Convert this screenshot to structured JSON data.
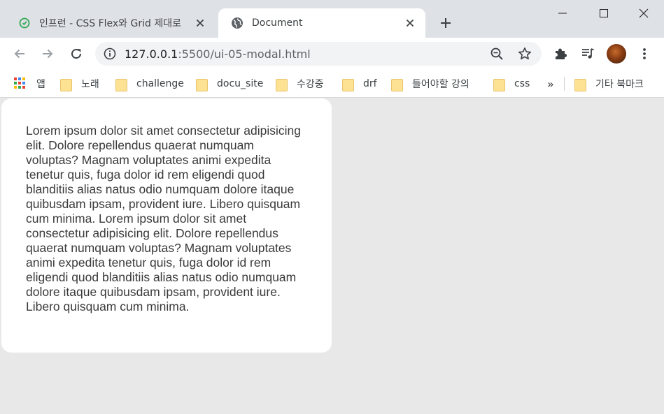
{
  "tabs": [
    {
      "title": "인프런 - CSS Flex와 Grid 제대로",
      "active": false
    },
    {
      "title": "Document",
      "active": true
    }
  ],
  "address_bar": {
    "host": "127.0.0.1",
    "rest": ":5500/ui-05-modal.html"
  },
  "bookmarks": {
    "apps_label": "앱",
    "items": [
      "노래",
      "challenge",
      "docu_site",
      "수강중",
      "drf",
      "들어야할 강의",
      "css"
    ],
    "overflow": "»",
    "other": "기타 북마크"
  },
  "modal": {
    "text": "Lorem ipsum dolor sit amet consectetur adipisicing elit. Dolore repellendus quaerat numquam voluptas? Magnam voluptates animi expedita tenetur quis, fuga dolor id rem eligendi quod blanditiis alias natus odio numquam dolore itaque quibusdam ipsam, provident iure. Libero quisquam cum minima. Lorem ipsum dolor sit amet consectetur adipisicing elit. Dolore repellendus quaerat numquam voluptas? Magnam voluptates animi expedita tenetur quis, fuga dolor id rem eligendi quod blanditiis alias natus odio numquam dolore itaque quibusdam ipsam, provident iure. Libero quisquam cum minima."
  },
  "colors": {
    "tabstrip": "#dee1e6",
    "page_background": "#e8e8e8",
    "modal_background": "#ffffff",
    "folder": "#fde293"
  },
  "icons": {
    "inactive_tab_favicon": "inflearn-icon",
    "active_tab_favicon": "globe-icon",
    "site_info": "info-icon",
    "zoom": "zoom-out-icon",
    "bookmark": "star-icon",
    "extensions": "puzzle-icon",
    "media": "media-control-icon",
    "menu": "kebab-menu-icon"
  }
}
